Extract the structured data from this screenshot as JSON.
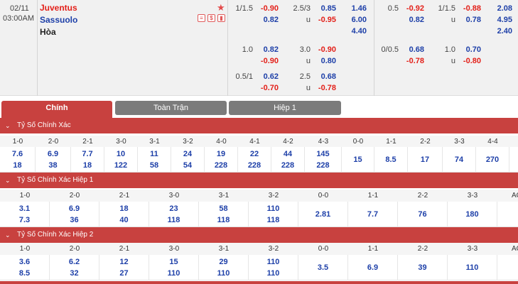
{
  "match": {
    "date": "02/11",
    "time": "03:00AM",
    "home": "Juventus",
    "away": "Sassuolo",
    "draw": "Hòa"
  },
  "odds": {
    "ft_hdp": [
      {
        "line": "1/1.5",
        "home": "-0.90",
        "away": "0.82"
      },
      {
        "line": "1.0",
        "home": "0.82",
        "away": "-0.90"
      },
      {
        "line": "0.5/1",
        "home": "0.62",
        "away": "-0.70"
      }
    ],
    "ft_ou": [
      {
        "line": "2.5/3",
        "over": "0.85",
        "under": "-0.95",
        "u": "u"
      },
      {
        "line": "3.0",
        "over": "-0.90",
        "under": "0.80",
        "u": "u"
      },
      {
        "line": "2.5",
        "over": "0.68",
        "under": "-0.78",
        "u": "u"
      }
    ],
    "ft_1x2": [
      "1.46",
      "6.00",
      "4.40"
    ],
    "h1_hdp": [
      {
        "line": "0.5",
        "home": "-0.92",
        "away": "0.82"
      },
      {
        "line": "0/0.5",
        "home": "0.68",
        "away": "-0.78"
      }
    ],
    "h1_ou": [
      {
        "line": "1/1.5",
        "over": "-0.88",
        "under": "0.78",
        "u": "u"
      },
      {
        "line": "1.0",
        "over": "0.70",
        "under": "-0.80",
        "u": "u"
      }
    ],
    "h1_1x2": [
      "2.08",
      "4.95",
      "2.40"
    ]
  },
  "tabs": [
    "Chính",
    "Toàn Trận",
    "Hiệp 1"
  ],
  "sections": [
    {
      "title": "Tỷ Số Chính Xác",
      "labels": [
        "1-0",
        "2-0",
        "2-1",
        "3-0",
        "3-1",
        "3-2",
        "4-0",
        "4-1",
        "4-2",
        "4-3",
        "0-0",
        "1-1",
        "2-2",
        "3-3",
        "4-4"
      ],
      "top": [
        "7.6",
        "6.9",
        "7.7",
        "10",
        "11",
        "24",
        "19",
        "22",
        "44",
        "145"
      ],
      "bottom": [
        "18",
        "38",
        "18",
        "122",
        "58",
        "54",
        "228",
        "228",
        "228",
        "228"
      ],
      "mid": [
        "15",
        "8.5",
        "17",
        "74",
        "270"
      ]
    },
    {
      "title": "Tỷ Số Chính Xác Hiệp 1",
      "labels": [
        "1-0",
        "2-0",
        "2-1",
        "3-0",
        "3-1",
        "3-2",
        "0-0",
        "1-1",
        "2-2",
        "3-3",
        "AO"
      ],
      "top": [
        "3.1",
        "6.9",
        "18",
        "23",
        "58",
        "110"
      ],
      "bottom": [
        "7.3",
        "36",
        "40",
        "118",
        "118",
        "118"
      ],
      "mid": [
        "2.81",
        "7.7",
        "76",
        "180",
        ""
      ]
    },
    {
      "title": "Tỷ Số Chính Xác Hiệp 2",
      "labels": [
        "1-0",
        "2-0",
        "2-1",
        "3-0",
        "3-1",
        "3-2",
        "0-0",
        "1-1",
        "2-2",
        "3-3",
        "AO"
      ],
      "top": [
        "3.6",
        "6.2",
        "12",
        "15",
        "29",
        "110"
      ],
      "bottom": [
        "8.5",
        "32",
        "27",
        "110",
        "110",
        "110"
      ],
      "mid": [
        "3.5",
        "6.9",
        "39",
        "110",
        ""
      ]
    }
  ]
}
